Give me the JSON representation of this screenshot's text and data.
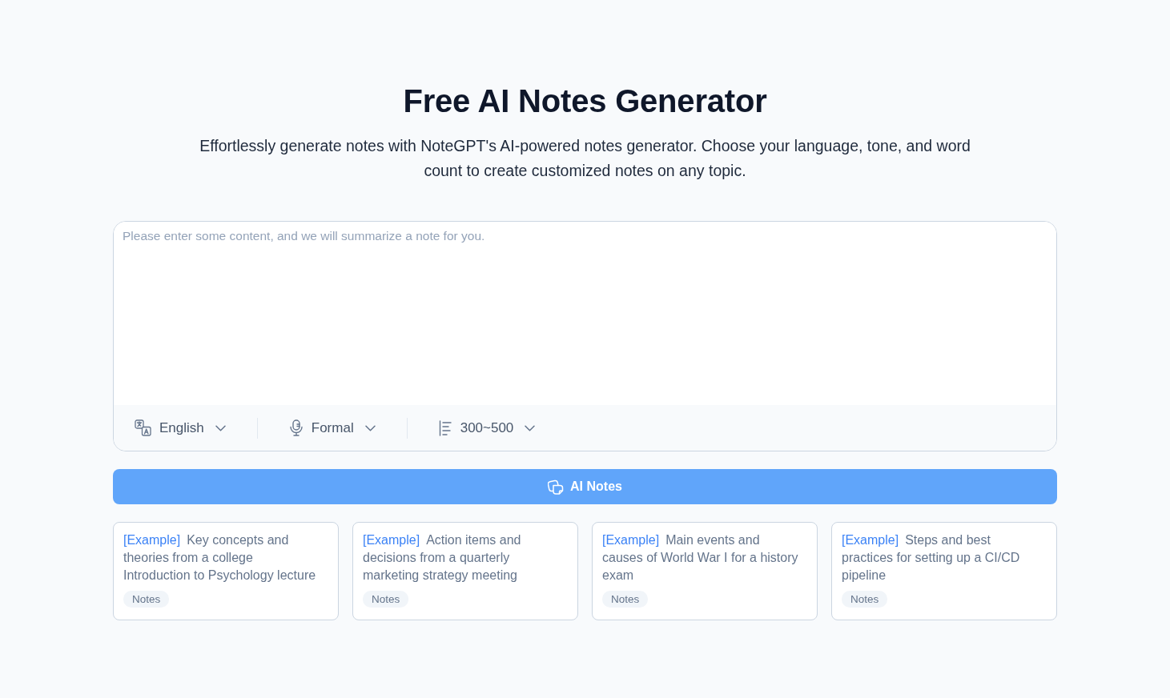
{
  "header": {
    "title": "Free AI Notes Generator",
    "subtitle": "Effortlessly generate notes with NoteGPT's AI-powered notes generator. Choose your language, tone, and word count to create customized notes on any topic."
  },
  "editor": {
    "placeholder": "Please enter some content, and we will summarize a note for you.",
    "options": [
      {
        "kind": "language",
        "value": "English"
      },
      {
        "kind": "tone",
        "value": "Formal"
      },
      {
        "kind": "length",
        "value": "300~500"
      }
    ]
  },
  "generate_button": {
    "label": "AI Notes"
  },
  "examples": [
    {
      "tag": "[Example]",
      "text": "Key concepts and theories from a college Introduction to Psychology lecture",
      "badge": "Notes"
    },
    {
      "tag": "[Example]",
      "text": "Action items and decisions from a quarterly marketing strategy meeting",
      "badge": "Notes"
    },
    {
      "tag": "[Example]",
      "text": "Main events and causes of World War I for a history exam",
      "badge": "Notes"
    },
    {
      "tag": "[Example]",
      "text": "Steps and best practices for setting up a CI/CD pipeline",
      "badge": "Notes"
    }
  ]
}
